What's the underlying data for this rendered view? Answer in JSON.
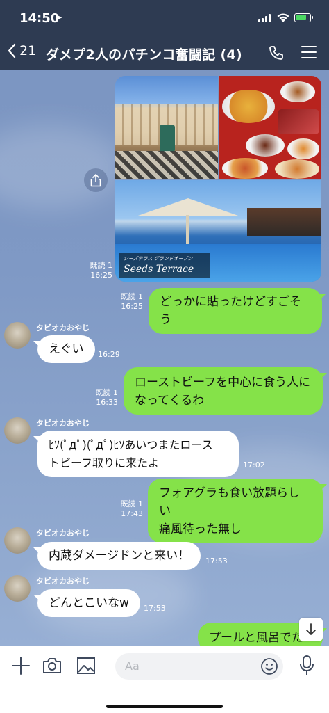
{
  "status": {
    "time": "14:50"
  },
  "header": {
    "back_count": "21",
    "title": "ダメプ2人のパチンコ奮闘記 (4)"
  },
  "photos": {
    "caption": "Seeds Terrace",
    "caption_small": "シーズテラス  グランドオープン"
  },
  "messages": [
    {
      "side": "right",
      "type": "image",
      "read": "既読 1",
      "time": "16:25"
    },
    {
      "side": "right",
      "text": "どっかに貼ったけどすごそう",
      "read": "既読 1",
      "time": "16:25"
    },
    {
      "side": "left",
      "sender": "タピオカおやじ",
      "text": "えぐい",
      "time": "16:29"
    },
    {
      "side": "right",
      "line1": "ローストビーフを中心に食う人に",
      "line2": "なってくるわ",
      "read": "既読 1",
      "time": "16:33"
    },
    {
      "side": "left",
      "sender": "タピオカおやじ",
      "line1": "ﾋｿ(ﾟдﾟ)(ﾟдﾟ)ﾋｿあいつまたロース",
      "line2": "トビーフ取りに来たよ",
      "time": "17:02"
    },
    {
      "side": "right",
      "line1": "フォアグラも食い放題らしい",
      "line2": "痛風待った無し",
      "read": "既読 1",
      "time": "17:43"
    },
    {
      "side": "left",
      "sender": "タピオカおやじ",
      "text": "内蔵ダメージドンと来い！",
      "time": "17:53"
    },
    {
      "side": "left",
      "sender": "タピオカおやじ",
      "text": "どんとこいなw",
      "time": "17:53"
    },
    {
      "side": "right",
      "text": "プールと風呂でた"
    }
  ],
  "input": {
    "placeholder": "Aa"
  },
  "colors": {
    "header": "#2e3b52",
    "green_bubble": "#85e249",
    "chat_bg": "#7f99c5"
  },
  "icons": [
    "location-arrow-icon",
    "chevron-left-icon",
    "phone-icon",
    "menu-icon",
    "share-icon",
    "arrow-down-icon",
    "plus-icon",
    "camera-icon",
    "image-icon",
    "emoji-icon",
    "microphone-icon"
  ]
}
